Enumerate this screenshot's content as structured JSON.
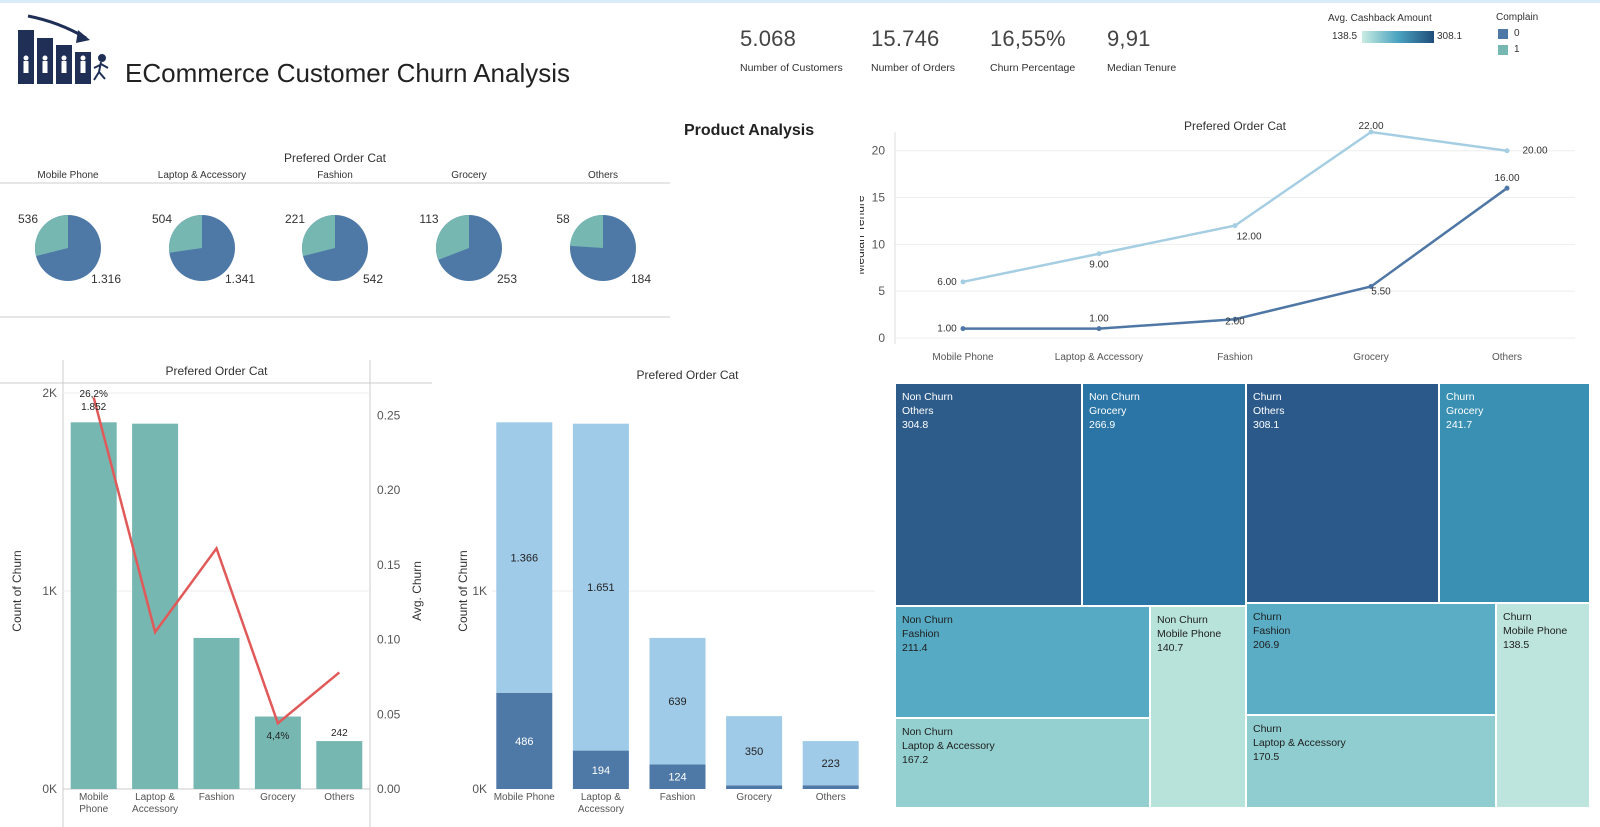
{
  "header": {
    "title": "ECommerce Customer Churn Analysis"
  },
  "kpis": [
    {
      "value": "5.068",
      "label": "Number of Customers"
    },
    {
      "value": "15.746",
      "label": "Number of Orders"
    },
    {
      "value": "16,55%",
      "label": "Churn Percentage"
    },
    {
      "value": "9,91",
      "label": "Median Tenure"
    }
  ],
  "legend_cashback": {
    "title": "Avg. Cashback Amount",
    "min": "138.5",
    "max": "308.1"
  },
  "legend_complain": {
    "title": "Complain",
    "items": [
      "0",
      "1"
    ],
    "colors": [
      "#4e79a7",
      "#76b7b2"
    ]
  },
  "section": {
    "product_analysis": "Product Analysis"
  },
  "pies": {
    "header": "Prefered Order Cat",
    "items": [
      {
        "category": "Mobile Phone",
        "small": "536",
        "large": "1.316",
        "small_value": 536,
        "large_value": 1316
      },
      {
        "category": "Laptop & Accessory",
        "small": "504",
        "large": "1.341",
        "small_value": 504,
        "large_value": 1341
      },
      {
        "category": "Fashion",
        "small": "221",
        "large": "542",
        "small_value": 221,
        "large_value": 542
      },
      {
        "category": "Grocery",
        "small": "113",
        "large": "253",
        "small_value": 113,
        "large_value": 253
      },
      {
        "category": "Others",
        "small": "58",
        "large": "184",
        "small_value": 58,
        "large_value": 184
      }
    ]
  },
  "chart_data": [
    {
      "id": "tenure_line",
      "type": "line",
      "title": "Prefered Order Cat",
      "ylabel": "Median Tenure",
      "categories": [
        "Mobile Phone",
        "Laptop & Accessory",
        "Fashion",
        "Grocery",
        "Others"
      ],
      "ylim": [
        0,
        22
      ],
      "yticks": [
        "0",
        "5",
        "10",
        "15",
        "20"
      ],
      "series": [
        {
          "values": [
            6,
            9,
            12,
            22,
            20
          ],
          "labels": [
            "6.00",
            "9.00",
            "12.00",
            "22.00",
            "20.00"
          ],
          "color": "#a6cee3"
        },
        {
          "values": [
            1,
            1,
            2,
            5.5,
            16
          ],
          "labels": [
            "1.00",
            "1.00",
            "2.00",
            "5.50",
            "16.00"
          ],
          "color": "#4f77a5"
        }
      ]
    },
    {
      "id": "churn_combo",
      "type": "bar",
      "title": "Prefered Order Cat",
      "ylabel": "Count of Churn",
      "y2label": "Avg. Churn",
      "categories": [
        "Mobile\nPhone",
        "Laptop &\nAccessory",
        "Fashion",
        "Grocery",
        "Others"
      ],
      "bars": [
        1852,
        1845,
        763,
        366,
        242
      ],
      "line": [
        0.262,
        0.105,
        0.161,
        0.044,
        0.078
      ],
      "ylim": [
        0,
        2000
      ],
      "y2lim": [
        0,
        0.265
      ],
      "yticks": [
        "2K",
        "1K",
        "0K"
      ],
      "y2ticks": [
        "0.25",
        "0.20",
        "0.15",
        "0.10",
        "0.05",
        "0.00"
      ],
      "labels": {
        "bar0_pct": "26,2%",
        "bar0_value": "1.852",
        "bar3_pct": "4,4%",
        "bar4_value": "242"
      },
      "bar_color": "#76b7b2",
      "line_color": "#e05a5a"
    },
    {
      "id": "churn_stacked",
      "type": "bar",
      "title": "Prefered Order Cat",
      "ylabel": "Count of Churn",
      "categories": [
        "Mobile Phone",
        "Laptop &\nAccessory",
        "Fashion",
        "Grocery",
        "Others"
      ],
      "series": [
        {
          "values": [
            486,
            194,
            124,
            18,
            19
          ],
          "labels": [
            "486",
            "194",
            "124",
            "",
            ""
          ],
          "color": "#4e79a7"
        },
        {
          "values": [
            1366,
            1651,
            639,
            350,
            223
          ],
          "labels": [
            "1.366",
            "1.651",
            "639",
            "350",
            "223"
          ],
          "color": "#a0cbe8"
        }
      ],
      "ylim": [
        0,
        2000
      ],
      "yticks": [
        "1K",
        "0K"
      ]
    }
  ],
  "treemap": {
    "cells": [
      {
        "group": "Non Churn",
        "category": "Others",
        "value": "304.8",
        "color": "#2e5c8a",
        "text": "#ffffff"
      },
      {
        "group": "Non Churn",
        "category": "Grocery",
        "value": "266.9",
        "color": "#2a75a6",
        "text": "#ffffff"
      },
      {
        "group": "Churn",
        "category": "Others",
        "value": "308.1",
        "color": "#2b5a8a",
        "text": "#ffffff"
      },
      {
        "group": "Churn",
        "category": "Grocery",
        "value": "241.7",
        "color": "#3a90b3",
        "text": "#ffffff"
      },
      {
        "group": "Non Churn",
        "category": "Fashion",
        "value": "211.4",
        "color": "#57aac3",
        "text": "#1e1e1e"
      },
      {
        "group": "Non Churn",
        "category": "Mobile Phone",
        "value": "140.7",
        "color": "#b8e3db",
        "text": "#1e1e1e"
      },
      {
        "group": "Churn",
        "category": "Fashion",
        "value": "206.9",
        "color": "#5badc5",
        "text": "#1e1e1e"
      },
      {
        "group": "Churn",
        "category": "Mobile Phone",
        "value": "138.5",
        "color": "#bde5dd",
        "text": "#1e1e1e"
      },
      {
        "group": "Non Churn",
        "category": "Laptop & Accessory",
        "value": "167.2",
        "color": "#94d0d0",
        "text": "#1e1e1e"
      },
      {
        "group": "Churn",
        "category": "Laptop & Accessory",
        "value": "170.5",
        "color": "#8fcdd0",
        "text": "#1e1e1e"
      }
    ]
  }
}
